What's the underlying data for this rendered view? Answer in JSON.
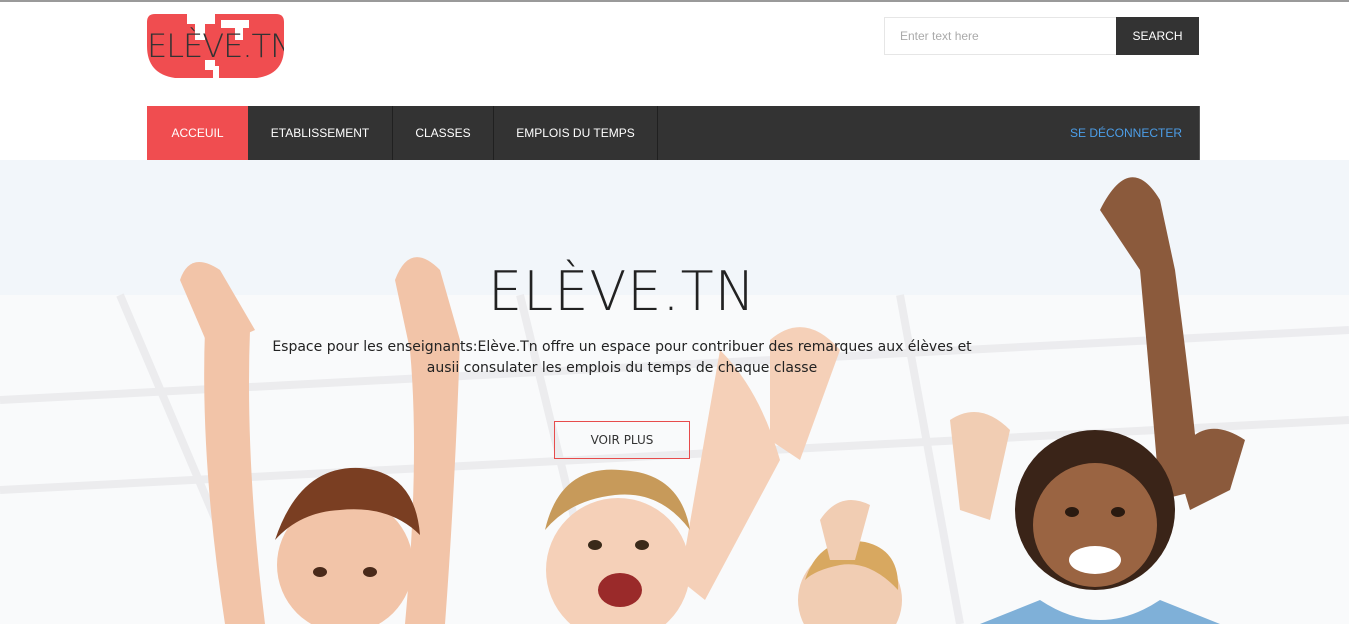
{
  "header": {
    "logo_text": "ELÈVE.TN",
    "search": {
      "placeholder": "Enter text here",
      "value": "",
      "button_label": "SEARCH"
    }
  },
  "nav": {
    "items": [
      {
        "label": "ACCEUIL",
        "active": true
      },
      {
        "label": "ETABLISSEMENT",
        "active": false
      },
      {
        "label": "CLASSES",
        "active": false
      },
      {
        "label": "EMPLOIS DU TEMPS",
        "active": false
      }
    ],
    "logout_label": "SE DÉCONNECTER"
  },
  "hero": {
    "title": "ELÈVE.TN",
    "description": "Espace pour les enseignants:Elève.Tn offre un espace pour contribuer des remarques aux élèves et ausii consulater les emplois du temps de chaque classe",
    "button_label": "VOIR PLUS"
  },
  "colors": {
    "accent": "#f04d50",
    "nav_bg": "#333333",
    "logout_link": "#4c9ee8"
  }
}
